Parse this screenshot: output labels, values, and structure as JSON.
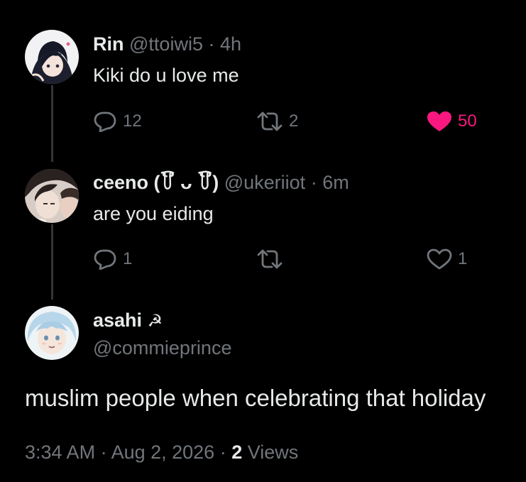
{
  "tweets": [
    {
      "name": "Rin",
      "handle": "@ttoiwi5",
      "separator": "·",
      "time": "4h",
      "text": "Kiki do u love me",
      "replies": "12",
      "retweets": "2",
      "likes": "50",
      "liked": true
    },
    {
      "name": "ceeno (꒦ິ ᴗ ꒦ິ)",
      "handle": "@ukeriiot",
      "separator": "·",
      "time": "6m",
      "text": "are you eiding",
      "replies": "1",
      "retweets": "",
      "likes": "1",
      "liked": false
    }
  ],
  "main_tweet": {
    "name": "asahi",
    "name_emoji": "☭",
    "handle": "@commieprince",
    "text": "muslim people when celebrating that holiday",
    "timestamp": "3:34 AM · Aug 2, 2026 · ",
    "views_count": "2",
    "views_label": " Views"
  },
  "colors": {
    "background": "#000000",
    "primary_text": "#e7e9ea",
    "secondary_text": "#71767b",
    "like_pink": "#f91880",
    "thread_line": "#333639"
  },
  "icons": [
    "reply-icon",
    "retweet-icon",
    "heart-icon",
    "hammer-sickle-emoji"
  ]
}
